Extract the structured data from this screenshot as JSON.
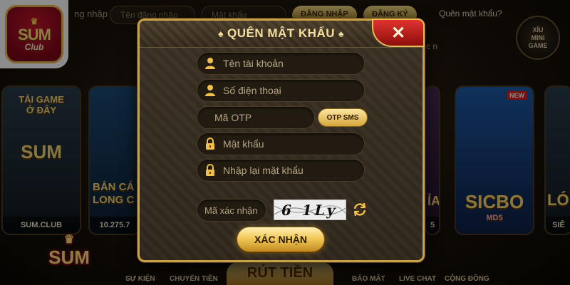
{
  "header": {
    "login_label_partial": "ng nhập",
    "username_placeholder": "Tên đăng nhập",
    "password_placeholder": "Mật khẩu",
    "login_button": "ĐĂNG NHẬP",
    "register_button": "ĐĂNG KÝ",
    "forgot_password": "Quên mật khẩu?",
    "mini_game": "XỈU\nMINI\nGAME",
    "side_text": "c n"
  },
  "logo": {
    "main": "SUM",
    "sub": "Club"
  },
  "cards": [
    {
      "title": "TẢI GAME\nỞ ĐÂY",
      "logo": "SUM",
      "caption": "SUM.CLUB"
    },
    {
      "title": "BẮN CÁ\nLONG C",
      "caption": "10.275.7"
    },
    {
      "title": "ỈA",
      "caption": "5"
    },
    {
      "title": "SICBO",
      "sub": "MD5",
      "badge": "NEW"
    },
    {
      "title": "LÓ",
      "caption": "SIÊ"
    }
  ],
  "bottom_nav": [
    "SỰ KIỆN",
    "CHUYỂN TIỀN",
    "RÚT TIỀN",
    "BẢO MẬT",
    "LIVE CHAT",
    "CỘNG ĐỒNG"
  ],
  "dialog": {
    "title": "QUÊN MẬT KHẨU",
    "close_icon": "✕",
    "fields": {
      "username": {
        "placeholder": "Tên tài khoản",
        "icon": "user-icon"
      },
      "phone": {
        "placeholder": "Số điện thoại",
        "icon": "user-icon"
      },
      "otp": {
        "placeholder": "Mã OTP"
      },
      "password": {
        "placeholder": "Mật khẩu",
        "icon": "lock-icon"
      },
      "confirm_password": {
        "placeholder": "Nhập lại mật khẩu",
        "icon": "lock-icon"
      },
      "captcha": {
        "placeholder": "Mã xác nhận"
      }
    },
    "otp_button": "OTP SMS",
    "captcha_image_text": "6 1Ly",
    "submit_button": "XÁC NHẬN"
  },
  "colors": {
    "gold": "#c9a04a",
    "close_red": "#c8201c",
    "dialog_bg": "#352b1f"
  }
}
